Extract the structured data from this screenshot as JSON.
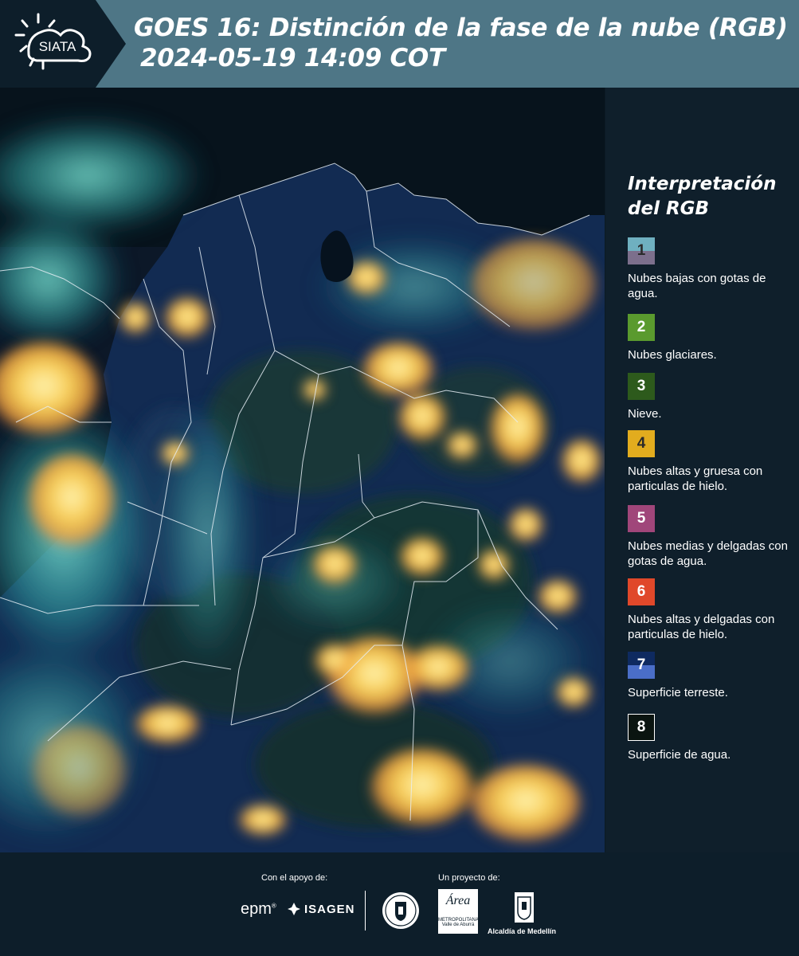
{
  "header": {
    "brand": "SIATA",
    "title_line1": "GOES 16: Distinción de la fase de la nube (RGB)",
    "title_line2": "2024-05-19 14:09 COT"
  },
  "legend": {
    "title_line1": "Interpretación",
    "title_line2": "del RGB",
    "items": [
      {
        "number": "1",
        "label": "Nubes bajas con gotas de agua.",
        "color_top": "#6fb0c0",
        "color_bottom": "#7c6f8c"
      },
      {
        "number": "2",
        "label": "Nubes glaciares.",
        "color": "#5a9a2e"
      },
      {
        "number": "3",
        "label": "Nieve.",
        "color": "#2d5a1c"
      },
      {
        "number": "4",
        "label": "Nubes altas y gruesa con particulas de hielo.",
        "color": "#e2ac1e"
      },
      {
        "number": "5",
        "label": "Nubes medias y delgadas con gotas de agua.",
        "color": "#a0467a"
      },
      {
        "number": "6",
        "label": "Nubes altas y delgadas con particulas de hielo.",
        "color": "#e0482a"
      },
      {
        "number": "7",
        "label": "Superficie terreste.",
        "color_top": "#0e2a60",
        "color_bottom": "#4a6ec8"
      },
      {
        "number": "8",
        "label": "Superficie de agua.",
        "color": "#0a1410"
      }
    ]
  },
  "footer": {
    "support_label": "Con el apoyo de:",
    "project_label": "Un proyecto de:",
    "sponsor1": "epm",
    "sponsor2": "ISAGEN",
    "partner_area_line1": "Área",
    "partner_area_line2": "METROPOLITANA",
    "partner_area_line3": "Valle de Aburrá",
    "partner_alcaldia": "Alcaldía de Medellín"
  },
  "colors": {
    "header_bar": "#4e7686",
    "background": "#0d1e2a",
    "cloud_high": "#f2c04a",
    "cloud_low": "#5fc9c9",
    "land": "#112a4e"
  }
}
